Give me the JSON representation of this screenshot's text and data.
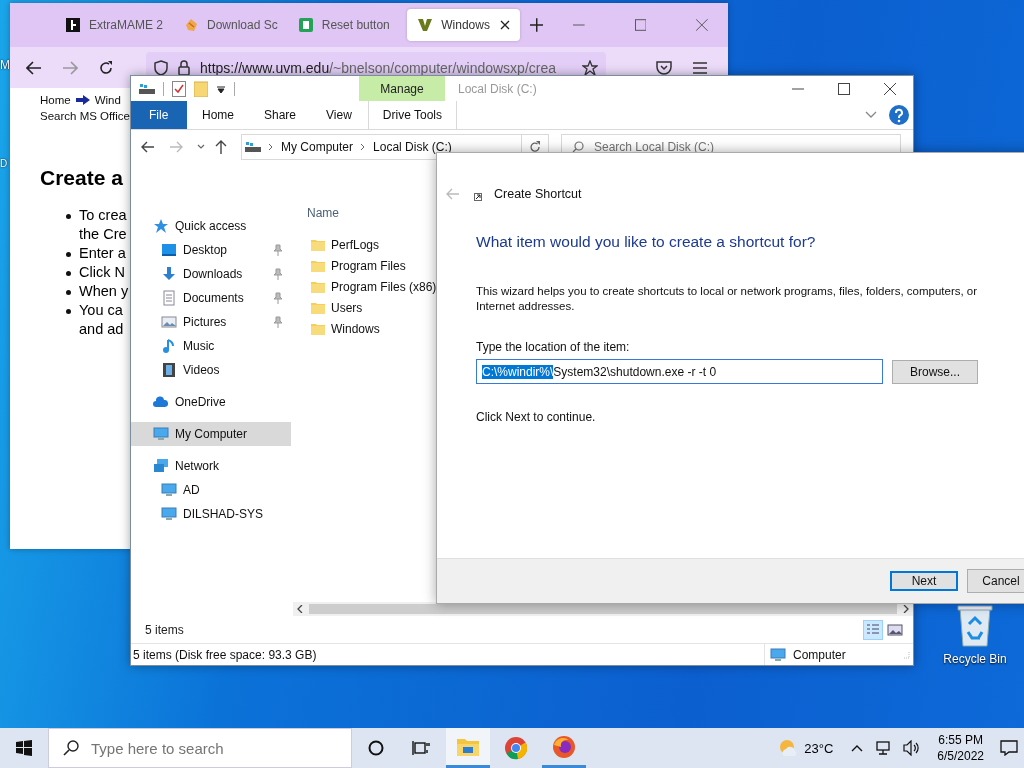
{
  "desktop": {
    "edge_labels": [
      "M",
      "D"
    ],
    "icons": [
      {
        "label": "Recycle Bin",
        "kind": "recycle-bin"
      }
    ]
  },
  "browser": {
    "tabs": [
      {
        "title": "ExtraMAME 2",
        "kind": "mame",
        "selected": false
      },
      {
        "title": "Download Sc",
        "kind": "hand",
        "selected": false
      },
      {
        "title": "Reset button",
        "kind": "green",
        "selected": false
      },
      {
        "title": "Windows",
        "kind": "v",
        "selected": true
      }
    ],
    "url_host": "https://www.uvm.edu",
    "url_path": "/~bnelson/computer/windowsxp/crea",
    "page": {
      "breadcrumb": [
        "Home",
        "Wind"
      ],
      "search_link": "Search MS Office",
      "heading": "Create a",
      "bullets": [
        [
          "To crea",
          "the Cre"
        ],
        [
          "Enter a"
        ],
        [
          "Click N"
        ],
        [
          "When y"
        ],
        [
          "You ca",
          "and ad"
        ]
      ]
    }
  },
  "explorer": {
    "title": "Local Disk (C:)",
    "context_group": "Manage",
    "ribbon_tabs": [
      {
        "label": "File",
        "kind": "file"
      },
      {
        "label": "Home",
        "kind": "tab"
      },
      {
        "label": "Share",
        "kind": "tab"
      },
      {
        "label": "View",
        "kind": "tab"
      },
      {
        "label": "Drive Tools",
        "kind": "context"
      }
    ],
    "address": [
      "My Computer",
      "Local Disk (C:)"
    ],
    "search": {
      "placeholder": "Search Local Disk (C:)"
    },
    "nav": [
      {
        "label": "Quick access",
        "kind": "star",
        "selected": false,
        "children": [
          {
            "label": "Desktop",
            "kind": "desktop",
            "pinned": true,
            "selected": false
          },
          {
            "label": "Downloads",
            "kind": "downloads",
            "pinned": true,
            "selected": false
          },
          {
            "label": "Documents",
            "kind": "documents",
            "pinned": true,
            "selected": false
          },
          {
            "label": "Pictures",
            "kind": "pictures",
            "pinned": true,
            "selected": false
          },
          {
            "label": "Music",
            "kind": "music",
            "pinned": false,
            "selected": false
          },
          {
            "label": "Videos",
            "kind": "videos",
            "pinned": false,
            "selected": false
          }
        ]
      },
      {
        "label": "OneDrive",
        "kind": "cloud",
        "selected": false
      },
      {
        "label": "My Computer",
        "kind": "computer",
        "selected": true
      },
      {
        "label": "Network",
        "kind": "network",
        "selected": false,
        "children": [
          {
            "label": "AD",
            "kind": "computer",
            "pinned": false,
            "selected": false
          },
          {
            "label": "DILSHAD-SYS",
            "kind": "computer",
            "pinned": false,
            "selected": false
          }
        ]
      }
    ],
    "column": "Name",
    "files": [
      "PerfLogs",
      "Program Files",
      "Program Files (x86)",
      "Users",
      "Windows"
    ],
    "item_count": "5 items",
    "view_buttons": [
      {
        "kind": "details",
        "selected": true
      },
      {
        "kind": "large-icons",
        "selected": false
      }
    ],
    "status": "5 items (Disk free space: 93.3 GB)",
    "status_location": "Computer"
  },
  "dialog": {
    "title": "Create Shortcut",
    "heading": "What item would you like to create a shortcut for?",
    "description": "This wizard helps you to create shortcuts to local or network programs, files, folders, computers, or Internet addresses.",
    "field_label": "Type the location of the item:",
    "field": {
      "selected_text": "C:\\%windir%\\",
      "value": "System32\\shutdown.exe -r -t 0"
    },
    "browse": "Browse...",
    "hint": "Click Next to continue.",
    "buttons": [
      {
        "label": "Next",
        "default": true
      },
      {
        "label": "Cancel",
        "default": false
      }
    ]
  },
  "taskbar": {
    "search_placeholder": "Type here to search",
    "apps": [
      {
        "kind": "explorer",
        "running": true,
        "active": true
      },
      {
        "kind": "chrome",
        "running": false,
        "active": false
      },
      {
        "kind": "firefox",
        "running": true,
        "active": false
      }
    ],
    "weather": "23°C",
    "time": "6:55 PM",
    "date": "6/5/2022"
  }
}
